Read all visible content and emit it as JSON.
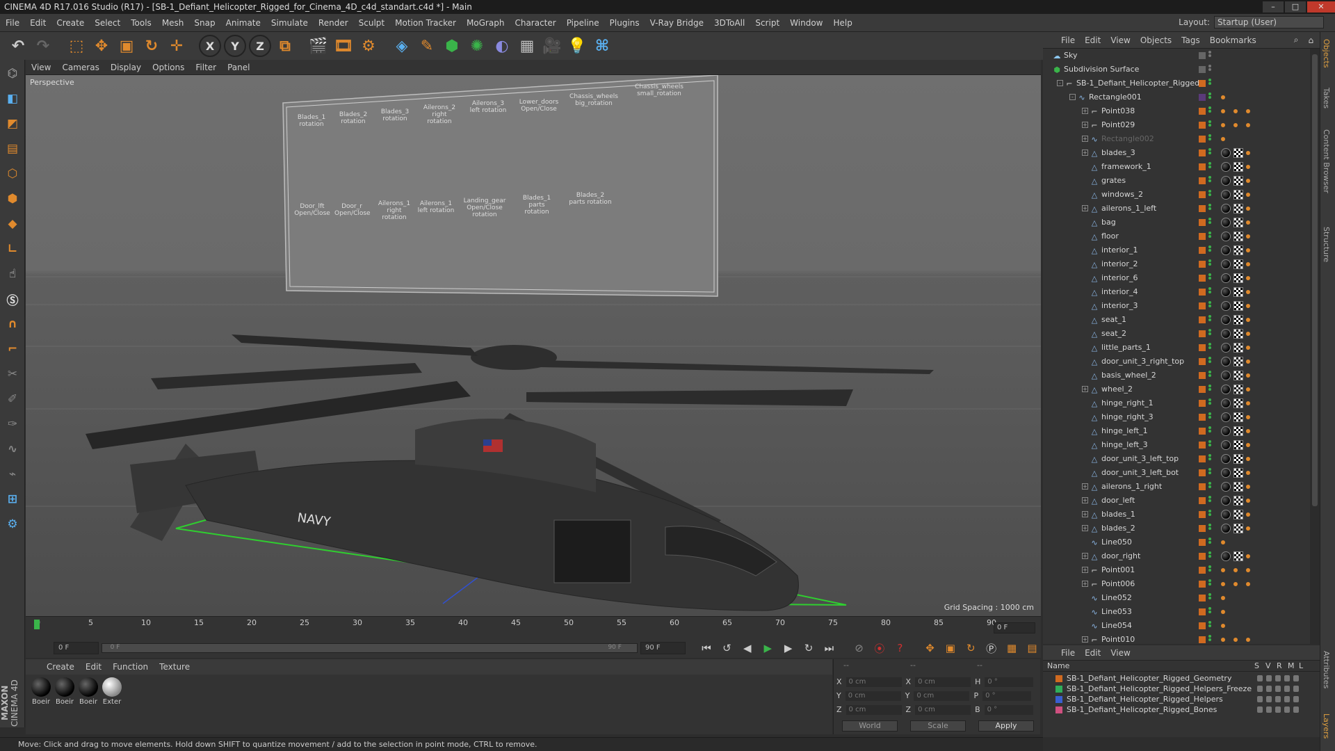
{
  "window": {
    "title": "CINEMA 4D R17.016 Studio (R17) - [SB-1_Defiant_Helicopter_Rigged_for_Cinema_4D_c4d_standart.c4d *] - Main"
  },
  "menu": [
    "File",
    "Edit",
    "Create",
    "Select",
    "Tools",
    "Mesh",
    "Snap",
    "Animate",
    "Simulate",
    "Render",
    "Sculpt",
    "Motion Tracker",
    "MoGraph",
    "Character",
    "Pipeline",
    "Plugins",
    "V-Ray Bridge",
    "3DToAll",
    "Script",
    "Window",
    "Help"
  ],
  "layout": {
    "label": "Layout:",
    "value": "Startup (User)"
  },
  "toolbar": {
    "icons": [
      "undo-icon",
      "redo-icon",
      "select-icon",
      "move-icon",
      "scale-icon",
      "rotate-icon",
      "transform-icon",
      "axis-x-icon",
      "axis-y-icon",
      "axis-z-icon",
      "coord-system-icon",
      "render-view-icon",
      "render-picture-queue-icon",
      "render-settings-icon",
      "cube-icon",
      "pen-icon",
      "subdivision-icon",
      "cloner-icon",
      "deformer-icon",
      "floor-icon",
      "camera-icon",
      "light-icon",
      "python-icon"
    ],
    "axis_labels": [
      "X",
      "Y",
      "Z"
    ]
  },
  "left_tools": [
    "make-editable-icon",
    "model-mode-icon",
    "texture-mode-icon",
    "workplane-icon",
    "points-mode-icon",
    "edges-mode-icon",
    "polygons-mode-icon",
    "axis-mode-icon",
    "tweak-icon",
    "soft-selection-icon",
    "magnet-icon",
    "joint-icon",
    "knife-icon",
    "brush-icon",
    "sculpt-icon",
    "smooth-icon",
    "grid-icon",
    "snap-icon",
    "python-icon"
  ],
  "viewport": {
    "menu": [
      "View",
      "Cameras",
      "Display",
      "Options",
      "Filter",
      "Panel"
    ],
    "label": "Perspective",
    "grid_spacing": "Grid Spacing : 1000 cm",
    "rig_board": {
      "top_labels": [
        "Blades_1 rotation",
        "Blades_2 rotation",
        "Blades_3 rotation",
        "Ailerons_2 right rotation",
        "Ailerons_3 left rotation",
        "Lower_doors Open/Close",
        "Chassis_wheels big_rotation",
        "Chassis_wheels small_rotation"
      ],
      "bottom_labels": [
        "Door_lft Open/Close",
        "Door_r Open/Close",
        "Ailerons_1 right rotation",
        "Ailerons_1 left rotation",
        "Landing_gear Open/Close rotation",
        "Blades_1 parts rotation",
        "Blades_2 parts rotation"
      ]
    }
  },
  "timeline": {
    "ticks": [
      "0",
      "5",
      "10",
      "15",
      "20",
      "25",
      "30",
      "35",
      "40",
      "45",
      "50",
      "55",
      "60",
      "65",
      "70",
      "75",
      "80",
      "85",
      "90"
    ],
    "current_frame": "0 F",
    "start_field": "0 F",
    "range_start": "0 F",
    "range_end": "90 F",
    "end_field": "90 F"
  },
  "materials": {
    "menu": [
      "Create",
      "Edit",
      "Function",
      "Texture"
    ],
    "items": [
      "Boeir",
      "Boeir",
      "Boeir",
      "Exter"
    ]
  },
  "coordinates": {
    "headers": [
      "--",
      "--",
      "--"
    ],
    "rows": [
      {
        "a": "X",
        "v1": "0 cm",
        "b": "X",
        "v2": "0 cm",
        "c": "H",
        "v3": "0 °"
      },
      {
        "a": "Y",
        "v1": "0 cm",
        "b": "Y",
        "v2": "0 cm",
        "c": "P",
        "v3": "0 °"
      },
      {
        "a": "Z",
        "v1": "0 cm",
        "b": "Z",
        "v2": "0 cm",
        "c": "B",
        "v3": "0 °"
      }
    ],
    "world": "World",
    "scale": "Scale",
    "apply": "Apply"
  },
  "objects_panel": {
    "menu": [
      "File",
      "Edit",
      "View",
      "Objects",
      "Tags",
      "Bookmarks"
    ],
    "rows": [
      {
        "name": "Sky",
        "indent": 0,
        "icon": "sky-icon"
      },
      {
        "name": "Subdivision Surface",
        "indent": 0,
        "icon": "subdivision-icon"
      },
      {
        "name": "SB-1_Defiant_Helicopter_Rigged",
        "indent": 1,
        "icon": "null-icon",
        "expand": "-"
      },
      {
        "name": "Rectangle001",
        "indent": 2,
        "icon": "spline-icon",
        "expand": "-"
      },
      {
        "name": "Point038",
        "indent": 3,
        "icon": "null-icon",
        "expand": "+"
      },
      {
        "name": "Point029",
        "indent": 3,
        "icon": "null-icon",
        "expand": "+"
      },
      {
        "name": "Rectangle002",
        "indent": 3,
        "icon": "spline-icon",
        "expand": "+",
        "dim": true
      },
      {
        "name": "blades_3",
        "indent": 3,
        "icon": "mesh-icon",
        "expand": "+"
      },
      {
        "name": "framework_1",
        "indent": 3,
        "icon": "mesh-icon"
      },
      {
        "name": "grates",
        "indent": 3,
        "icon": "mesh-icon"
      },
      {
        "name": "windows_2",
        "indent": 3,
        "icon": "mesh-icon"
      },
      {
        "name": "ailerons_1_left",
        "indent": 3,
        "icon": "mesh-icon",
        "expand": "+"
      },
      {
        "name": "bag",
        "indent": 3,
        "icon": "mesh-icon"
      },
      {
        "name": "floor",
        "indent": 3,
        "icon": "mesh-icon"
      },
      {
        "name": "interior_1",
        "indent": 3,
        "icon": "mesh-icon"
      },
      {
        "name": "interior_2",
        "indent": 3,
        "icon": "mesh-icon"
      },
      {
        "name": "interior_6",
        "indent": 3,
        "icon": "mesh-icon"
      },
      {
        "name": "interior_4",
        "indent": 3,
        "icon": "mesh-icon"
      },
      {
        "name": "interior_3",
        "indent": 3,
        "icon": "mesh-icon"
      },
      {
        "name": "seat_1",
        "indent": 3,
        "icon": "mesh-icon"
      },
      {
        "name": "seat_2",
        "indent": 3,
        "icon": "mesh-icon"
      },
      {
        "name": "little_parts_1",
        "indent": 3,
        "icon": "mesh-icon"
      },
      {
        "name": "door_unit_3_right_top",
        "indent": 3,
        "icon": "mesh-icon"
      },
      {
        "name": "basis_wheel_2",
        "indent": 3,
        "icon": "mesh-icon"
      },
      {
        "name": "wheel_2",
        "indent": 3,
        "icon": "mesh-icon",
        "expand": "+"
      },
      {
        "name": "hinge_right_1",
        "indent": 3,
        "icon": "mesh-icon"
      },
      {
        "name": "hinge_right_3",
        "indent": 3,
        "icon": "mesh-icon"
      },
      {
        "name": "hinge_left_1",
        "indent": 3,
        "icon": "mesh-icon"
      },
      {
        "name": "hinge_left_3",
        "indent": 3,
        "icon": "mesh-icon"
      },
      {
        "name": "door_unit_3_left_top",
        "indent": 3,
        "icon": "mesh-icon"
      },
      {
        "name": "door_unit_3_left_bot",
        "indent": 3,
        "icon": "mesh-icon"
      },
      {
        "name": "ailerons_1_right",
        "indent": 3,
        "icon": "mesh-icon",
        "expand": "+"
      },
      {
        "name": "door_left",
        "indent": 3,
        "icon": "mesh-icon",
        "expand": "+"
      },
      {
        "name": "blades_1",
        "indent": 3,
        "icon": "mesh-icon",
        "expand": "+"
      },
      {
        "name": "blades_2",
        "indent": 3,
        "icon": "mesh-icon",
        "expand": "+"
      },
      {
        "name": "Line050",
        "indent": 3,
        "icon": "spline-icon"
      },
      {
        "name": "door_right",
        "indent": 3,
        "icon": "mesh-icon",
        "expand": "+"
      },
      {
        "name": "Point001",
        "indent": 3,
        "icon": "null-icon",
        "expand": "+"
      },
      {
        "name": "Point006",
        "indent": 3,
        "icon": "null-icon",
        "expand": "+"
      },
      {
        "name": "Line052",
        "indent": 3,
        "icon": "spline-icon"
      },
      {
        "name": "Line053",
        "indent": 3,
        "icon": "spline-icon"
      },
      {
        "name": "Line054",
        "indent": 3,
        "icon": "spline-icon"
      },
      {
        "name": "Point010",
        "indent": 3,
        "icon": "null-icon",
        "expand": "+"
      }
    ]
  },
  "layers_panel": {
    "menu": [
      "File",
      "Edit",
      "View"
    ],
    "headers": {
      "name": "Name",
      "s": "S",
      "v": "V",
      "r": "R",
      "m": "M",
      "l": "L"
    },
    "rows": [
      {
        "name": "SB-1_Defiant_Helicopter_Rigged_Geometry",
        "color": "#d06a20"
      },
      {
        "name": "SB-1_Defiant_Helicopter_Rigged_Helpers_Freeze",
        "color": "#2fae5a"
      },
      {
        "name": "SB-1_Defiant_Helicopter_Rigged_Helpers",
        "color": "#3a5fd0"
      },
      {
        "name": "SB-1_Defiant_Helicopter_Rigged_Bones",
        "color": "#d05080"
      }
    ]
  },
  "right_tabs": [
    "Objects",
    "Takes",
    "Content Browser",
    "Structure",
    "Attributes",
    "Layers"
  ],
  "status": "Move: Click and drag to move elements. Hold down SHIFT to quantize movement / add to the selection in point mode, CTRL to remove.",
  "logo": {
    "brand": "MAXON",
    "product": "CINEMA 4D"
  },
  "colors": {
    "accent": "#e08a2d",
    "layer_orange": "#d06a20",
    "green": "#3ab44a"
  }
}
